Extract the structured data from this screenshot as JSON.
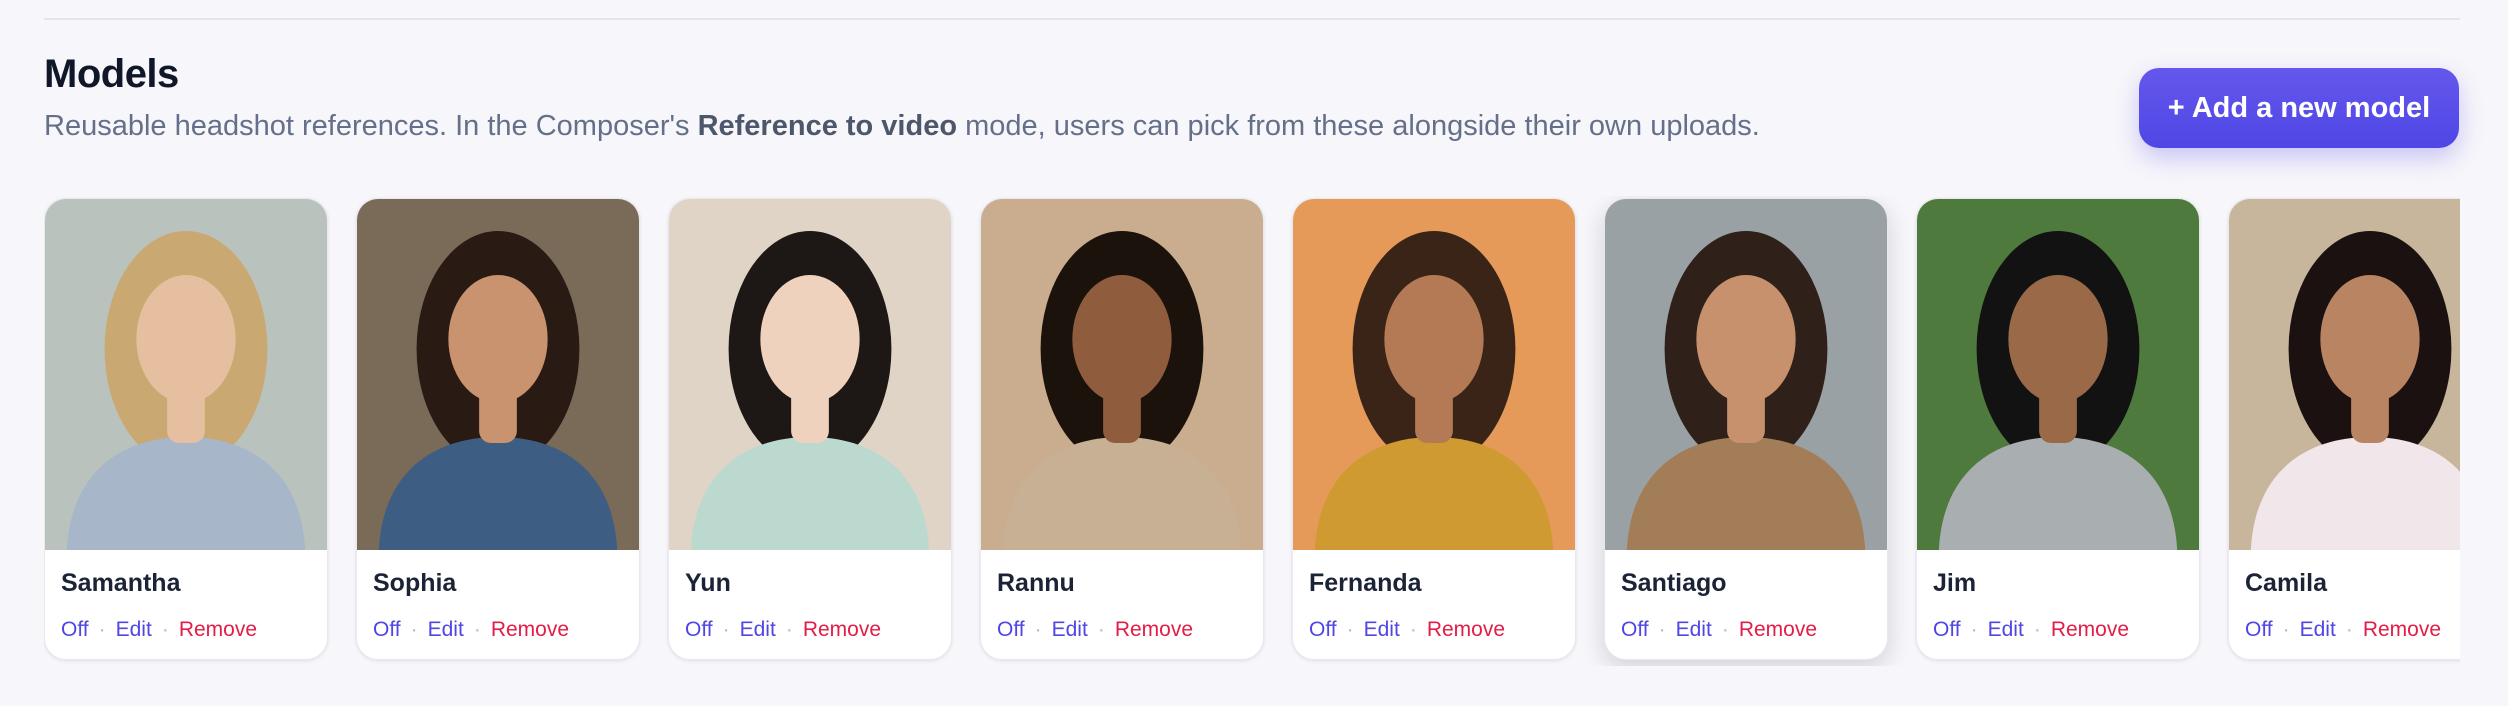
{
  "section": {
    "title": "Models",
    "subtitle_pre": "Reusable headshot references. In the Composer's ",
    "subtitle_bold": "Reference to video",
    "subtitle_post": " mode, users can pick from these alongside their own uploads."
  },
  "add_button": {
    "label": "+ Add a new model"
  },
  "action_labels": {
    "off": "Off",
    "edit": "Edit",
    "remove": "Remove",
    "separator": "·"
  },
  "models": [
    {
      "name": "Samantha",
      "bg": "#b9c2bc",
      "skin": "#e5bf9f",
      "hair": "#caa872",
      "top": "#a7b6c9"
    },
    {
      "name": "Sophia",
      "bg": "#7a6a58",
      "skin": "#c8936e",
      "hair": "#2a1a14",
      "top": "#3e5d83"
    },
    {
      "name": "Yun",
      "bg": "#e0d4c6",
      "skin": "#efd2bd",
      "hair": "#1d1715",
      "top": "#bcd9cf"
    },
    {
      "name": "Rannu",
      "bg": "#c9ad8e",
      "skin": "#8f5d3d",
      "hair": "#1c120c",
      "top": "#c8b095"
    },
    {
      "name": "Fernanda",
      "bg": "#e59a5a",
      "skin": "#b47a56",
      "hair": "#3a2418",
      "top": "#cf9a32"
    },
    {
      "name": "Santiago",
      "bg": "#9aa1a5",
      "skin": "#c6916c",
      "hair": "#2f2119",
      "top": "#a27d58"
    },
    {
      "name": "Jim",
      "bg": "#4f7a3e",
      "skin": "#9a6a48",
      "hair": "#121212",
      "top": "#a9aeb0"
    },
    {
      "name": "Camila",
      "bg": "#c7b59c",
      "skin": "#b98462",
      "hair": "#1a1110",
      "top": "#f1e7ea"
    }
  ],
  "colors": {
    "accent": "#4f46e5",
    "danger": "#e11d48"
  }
}
